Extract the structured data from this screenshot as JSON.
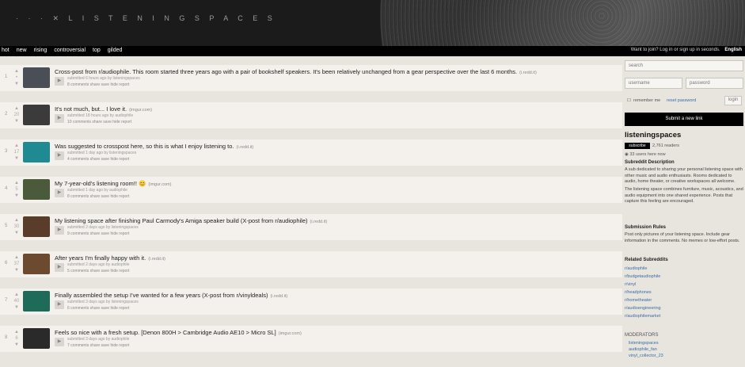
{
  "header": {
    "logo": "·  ·  ·   ✕   L I S T E N I N G S P A C E S"
  },
  "tabs": [
    "hot",
    "new",
    "rising",
    "controversial",
    "top",
    "gilded"
  ],
  "userbar": {
    "text": "Want to join? Log in or sign up in seconds.",
    "lang": "English"
  },
  "posts": [
    {
      "rank": "1",
      "score": "•",
      "title": "Cross-post from r/audiophile. This room started three years ago with a pair of bookshelf speakers. It's been relatively unchanged from a gear perspective over the last 6 months.",
      "domain": "(i.redd.it)",
      "tagline": "submitted 6 hours ago by listeningspaces",
      "buttons": "8 comments   share   save   hide   report",
      "thumb": "#4a4f57"
    },
    {
      "rank": "2",
      "score": "20",
      "title": "It's not much, but... I love it.",
      "domain": "(imgur.com)",
      "tagline": "submitted 18 hours ago by audiophile",
      "buttons": "10 comments   share   save   hide   report",
      "thumb": "#3b3b3b"
    },
    {
      "rank": "3",
      "score": "17",
      "title": "Was suggested to crosspost here, so this is what I enjoy listening to.",
      "domain": "(i.redd.it)",
      "tagline": "submitted 1 day ago by listeningspaces",
      "buttons": "4 comments   share   save   hide   report",
      "thumb": "#1f8a91"
    },
    {
      "rank": "4",
      "score": "5",
      "title": "My 7-year-old's listening room!! 😊",
      "domain": "(imgur.com)",
      "tagline": "submitted 1 day ago by audiophile",
      "buttons": "8 comments   share   save   hide   report",
      "thumb": "#4b5a3a"
    },
    {
      "rank": "5",
      "score": "30",
      "title": "My listening space after finishing Paul Carmody's Amiga speaker build (X-post from r/audiophile)",
      "domain": "(i.redd.it)",
      "tagline": "submitted 2 days ago by listeningspaces",
      "buttons": "9 comments   share   save   hide   report",
      "thumb": "#5a3c2a"
    },
    {
      "rank": "6",
      "score": "37",
      "title": "After years I'm finally happy with it.",
      "domain": "(i.redd.it)",
      "tagline": "submitted 2 days ago by audiophile",
      "buttons": "5 comments   share   save   hide   report",
      "thumb": "#6b4a30"
    },
    {
      "rank": "7",
      "score": "40",
      "title": "Finally assembled the setup I've wanted for a few years (X-post from r/vinyldeals)",
      "domain": "(i.redd.it)",
      "tagline": "submitted 3 days ago by listeningspaces",
      "buttons": "6 comments   share   save   hide   report",
      "thumb": "#1f6b5a"
    },
    {
      "rank": "8",
      "score": "6",
      "title": "Feels so nice with a fresh setup. [Denon 800H > Cambridge Audio AE10 > Micro SL]",
      "domain": "(imgur.com)",
      "tagline": "submitted 3 days ago by audiophile",
      "buttons": "7 comments   share   save   hide   report",
      "thumb": "#2a2a2a"
    }
  ],
  "sidebar": {
    "search_placeholder": "search",
    "username_placeholder": "username",
    "password_placeholder": "password",
    "remember": "remember me",
    "reset": "reset password",
    "login": "login",
    "submit": "Submit a new link",
    "subreddit": "listeningspaces",
    "subscribe": "subscribe",
    "subscribers": "2,761 readers",
    "online": "33 users here now",
    "desc_title": "Subreddit Description",
    "desc_1": "A sub dedicated to sharing your personal listening space with other music and audio enthusiasts. Rooms dedicated to audio, home theater, or creative workspaces all welcome.",
    "desc_2": "The listening space combines furniture, music, acoustics, and audio equipment into one shared experience. Posts that capture this feeling are encouraged.",
    "rules_title": "Submission Rules",
    "rules": "Post only pictures of your listening space. Include gear information in the comments. No memes or low-effort posts.",
    "related_title": "Related Subreddits",
    "related": [
      "r/audiophile",
      "r/budgetaudiophile",
      "r/vinyl",
      "r/headphones",
      "r/hometheater",
      "r/audioengineering",
      "r/audiophilemarket"
    ],
    "mods_title": "MODERATORS",
    "mods": [
      "listeningspaces",
      "audiophile_fan",
      "vinyl_collector_23"
    ]
  }
}
